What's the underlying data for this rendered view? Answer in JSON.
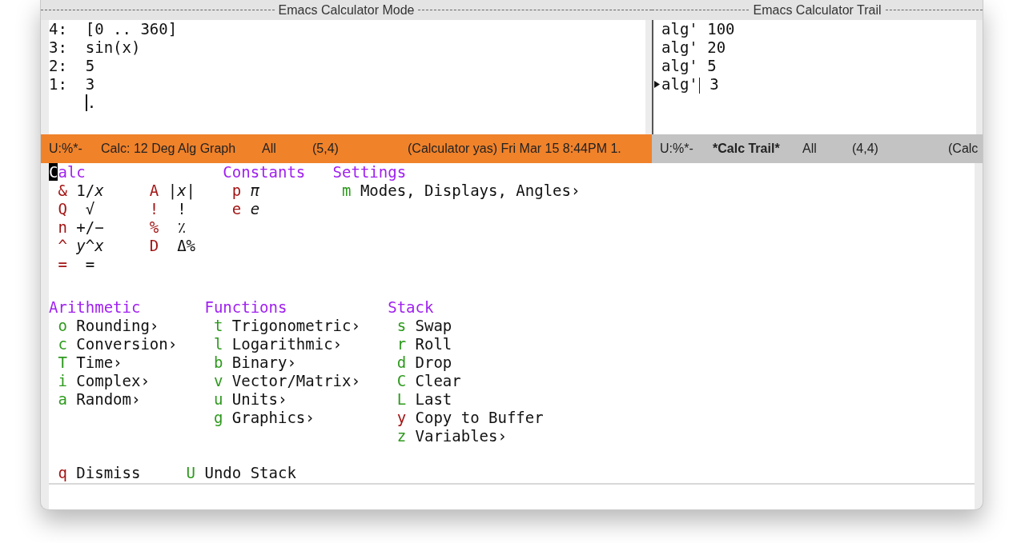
{
  "panes": [
    {
      "title": "Emacs Calculator Mode"
    },
    {
      "title": "Emacs Calculator Trail"
    }
  ],
  "stack": {
    "entries": [
      {
        "index": "4:",
        "value": "[0 .. 360]"
      },
      {
        "index": "3:",
        "value": "sin(x)"
      },
      {
        "index": "2:",
        "value": "5"
      },
      {
        "index": "1:",
        "value": "3"
      }
    ],
    "end_marker": "."
  },
  "trail": [
    {
      "op": "alg'",
      "value": "100",
      "current": false
    },
    {
      "op": "alg'",
      "value": "20",
      "current": false
    },
    {
      "op": "alg'",
      "value": "5",
      "current": false
    },
    {
      "op": "alg'",
      "value": "3",
      "current": true
    }
  ],
  "mode_lines": [
    {
      "active": true,
      "segments": [
        {
          "text": "U:%*-",
          "bold": false
        },
        {
          "text": "Calc: 12 Deg Alg Graph",
          "bold": false
        },
        {
          "text": "All",
          "bold": false
        },
        {
          "text": "(5,4)",
          "bold": false
        },
        {
          "text": "(Calculator yas) Fri Mar 15 8:44PM 1.",
          "bold": false
        }
      ]
    },
    {
      "active": false,
      "segments": [
        {
          "text": "U:%*-",
          "bold": false
        },
        {
          "text": "*Calc Trail*",
          "bold": true
        },
        {
          "text": "All",
          "bold": false
        },
        {
          "text": "(4,4)",
          "bold": false
        },
        {
          "text": "(Calc",
          "bold": false
        }
      ]
    }
  ],
  "menu": {
    "sections": [
      {
        "columns": [
          {
            "title": "Calc",
            "cursor": true,
            "items": [
              {
                "key": "&",
                "label": "1/*x*",
                "color": "#a31515"
              },
              {
                "key": "Q",
                "label": " √",
                "color": "#a31515"
              },
              {
                "key": "n",
                "label": "+/−",
                "color": "#a31515"
              },
              {
                "key": "^",
                "label": "*y*^*x*",
                "color": "#a31515"
              },
              {
                "key": "=",
                "label": " =",
                "color": "#a31515"
              }
            ]
          },
          {
            "items": [
              {
                "key": "A",
                "label": "|*x*|",
                "color": "#a31515"
              },
              {
                "key": "!",
                "label": " !",
                "color": "#a31515"
              },
              {
                "key": "%",
                "label": " ٪",
                "color": "#a31515"
              },
              {
                "key": "D",
                "label": " Δ%",
                "color": "#a31515"
              }
            ]
          },
          {
            "title": "Constants",
            "cursor": false,
            "items": [
              {
                "key": "p",
                "label": "*π*",
                "color": "#a31515"
              },
              {
                "key": "e",
                "label": "*e*",
                "color": "#a31515"
              }
            ]
          },
          {
            "title": "Settings",
            "cursor": false,
            "items": [
              {
                "key": "m",
                "label": "Modes, Displays, Angles›",
                "color": "#2e9a1e"
              }
            ]
          }
        ]
      },
      {
        "columns": [
          {
            "title": "Arithmetic",
            "cursor": false,
            "items": [
              {
                "key": "o",
                "label": "Rounding›",
                "color": "#2e9a1e"
              },
              {
                "key": "c",
                "label": "Conversion›",
                "color": "#2e9a1e"
              },
              {
                "key": "T",
                "label": "Time›",
                "color": "#2e9a1e"
              },
              {
                "key": "i",
                "label": "Complex›",
                "color": "#2e9a1e"
              },
              {
                "key": "a",
                "label": "Random›",
                "color": "#2e9a1e"
              }
            ]
          },
          {
            "title": "Functions",
            "cursor": false,
            "items": [
              {
                "key": "t",
                "label": "Trigonometric›",
                "color": "#2e9a1e"
              },
              {
                "key": "l",
                "label": "Logarithmic›",
                "color": "#2e9a1e"
              },
              {
                "key": "b",
                "label": "Binary›",
                "color": "#2e9a1e"
              },
              {
                "key": "v",
                "label": "Vector/Matrix›",
                "color": "#2e9a1e"
              },
              {
                "key": "u",
                "label": "Units›",
                "color": "#2e9a1e"
              },
              {
                "key": "g",
                "label": "Graphics›",
                "color": "#2e9a1e"
              }
            ]
          },
          {
            "title": "Stack",
            "cursor": false,
            "items": [
              {
                "key": "s",
                "label": "Swap",
                "color": "#2e9a1e"
              },
              {
                "key": "r",
                "label": "Roll",
                "color": "#2e9a1e"
              },
              {
                "key": "d",
                "label": "Drop",
                "color": "#2e9a1e"
              },
              {
                "key": "C",
                "label": "Clear",
                "color": "#2e9a1e"
              },
              {
                "key": "L",
                "label": "Last",
                "color": "#2e9a1e"
              },
              {
                "key": "y",
                "label": "Copy to Buffer",
                "color": "#a31515"
              },
              {
                "key": "z",
                "label": "Variables›",
                "color": "#2e9a1e"
              }
            ]
          }
        ]
      }
    ],
    "footer": [
      {
        "key": "q",
        "label": "Dismiss",
        "color": "#a31515"
      },
      {
        "key": "U",
        "label": "Undo Stack",
        "color": "#2e9a1e"
      }
    ]
  }
}
